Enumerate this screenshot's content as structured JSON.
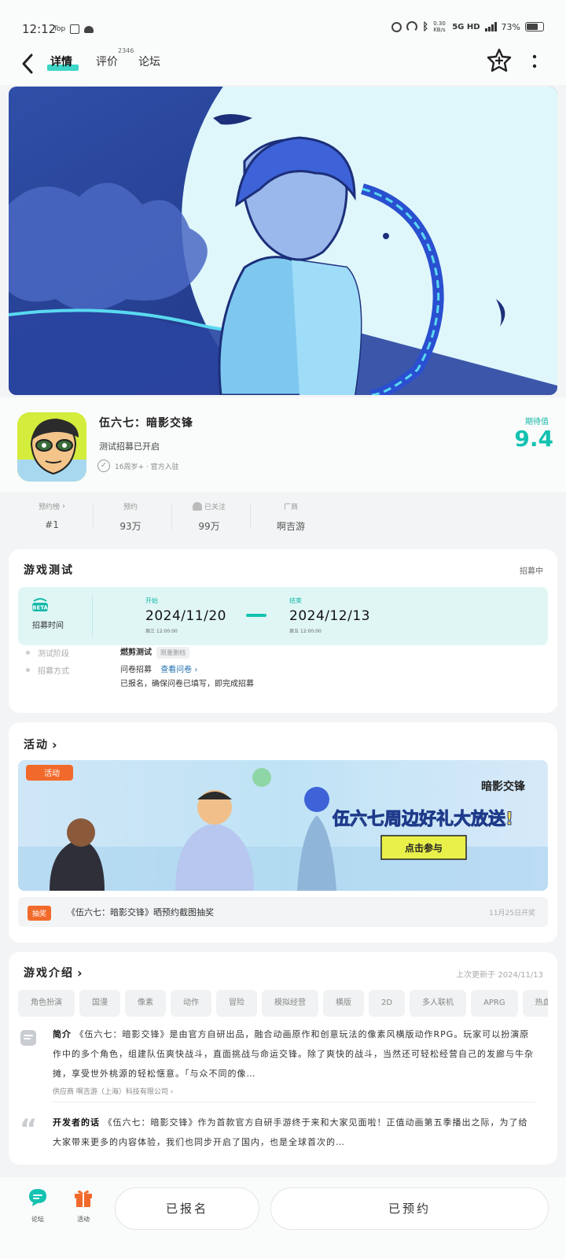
{
  "status_bar": {
    "time": "12:12",
    "left_icons": [
      "Top",
      "card-icon",
      "android-icon"
    ],
    "speed": "0.30 KB/s",
    "network": "5G HD",
    "battery": "73%",
    "battery_level": 0.73
  },
  "nav": {
    "tabs": [
      {
        "label": "详情",
        "active": true
      },
      {
        "label": "评价",
        "badge": "2346",
        "active": false
      },
      {
        "label": "论坛",
        "active": false
      }
    ]
  },
  "game": {
    "title": "伍六七：暗影交锋",
    "subtitle": "测试招募已开启",
    "meta": "16周岁+ · 官方入驻",
    "score_label": "期待值",
    "score": "9.4"
  },
  "stats": [
    {
      "label": "预约榜",
      "value": "#1"
    },
    {
      "label": "预约",
      "value": "93万"
    },
    {
      "label": "已关注",
      "value": "99万"
    },
    {
      "label": "厂商",
      "value": "啊吉游"
    }
  ],
  "test_section": {
    "title": "游戏测试",
    "status": "招募中",
    "beta_label": "BETA",
    "recruit_label": "招募时间",
    "start_label": "开始",
    "start_date": "2024/11/20",
    "start_time": "周三 12:00:00",
    "end_label": "结束",
    "end_date": "2024/12/13",
    "end_time": "周五 12:00:00",
    "phase_label": "测试阶段",
    "phase_value": "燃剪测试",
    "phase_tag": "限量删档",
    "method_label": "招募方式",
    "method_value": "问卷招募",
    "method_link": "查看问卷",
    "method_note": "已报名，确保问卷已填写，即完成招募"
  },
  "activity_section": {
    "title": "活动",
    "banner_tag": "活动",
    "banner_logo": "暗影交锋",
    "banner_headline": "伍六七周边好礼大放送!",
    "banner_button": "点击参与",
    "lottery_tag": "抽奖",
    "lottery_text": "《伍六七：暗影交锋》晒预约截图抽奖",
    "lottery_date": "11月25日开奖"
  },
  "intro_section": {
    "title": "游戏介绍",
    "updated": "上次更新于 2024/11/13",
    "tags": [
      "角色扮演",
      "国漫",
      "像素",
      "动作",
      "冒险",
      "模拟经营",
      "横版",
      "2D",
      "多人联机",
      "APRG",
      "热血"
    ],
    "intro_label": "简介",
    "intro_text": "《伍六七：暗影交锋》是由官方自研出品，融合动画原作和创意玩法的像素风横版动作RPG。玩家可以扮演原作中的多个角色，组建队伍爽快战斗，直面挑战与命运交锋。除了爽快的战斗，当然还可轻松经营自己的发廊与牛杂摊，享受世外桃源的轻松惬意。「与众不同的像…",
    "vendor": "供应商 啊吉游（上海）科技有限公司",
    "dev_label": "开发者的话",
    "dev_text": "《伍六七：暗影交锋》作为首款官方自研手游终于来和大家见面啦！正值动画第五季播出之际，为了给大家带来更多的内容体验，我们也同步开启了国内，也是全球首次的…"
  },
  "bottom_bar": {
    "forum_label": "论坛",
    "activity_label": "活动",
    "signup_button": "已报名",
    "reserve_button": "已预约"
  },
  "colors": {
    "accent": "#14c2b1",
    "orange": "#f26a2b",
    "link": "#1f6fb0"
  }
}
